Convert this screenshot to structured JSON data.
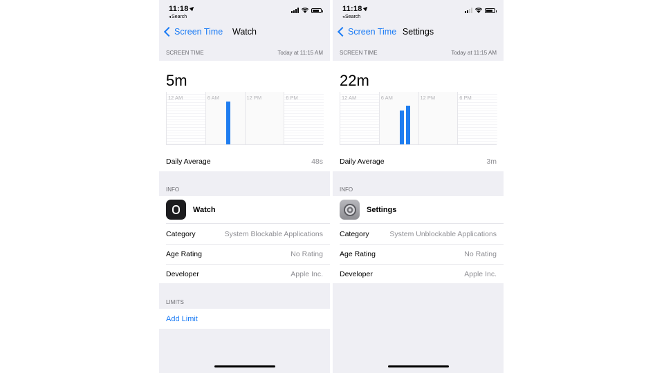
{
  "status": {
    "time": "11:18",
    "back_app": "Search"
  },
  "colors": {
    "accent": "#1a7bf5",
    "bar": "#1f7df0",
    "background": "#efeff4"
  },
  "left": {
    "nav": {
      "back_label": "Screen Time",
      "title": "Watch"
    },
    "screen_time_header": {
      "label": "SCREEN TIME",
      "timestamp": "Today at 11:15 AM"
    },
    "usage_total": "5m",
    "chart_data": {
      "type": "bar",
      "tick_labels": [
        "12 AM",
        "6 AM",
        "12 PM",
        "6 PM"
      ],
      "bars": [
        {
          "hour": 9,
          "relative_height": 1.0
        }
      ]
    },
    "daily_average": {
      "label": "Daily Average",
      "value": "48s"
    },
    "info_header": "INFO",
    "app": {
      "name": "Watch",
      "icon": "watch-app-icon"
    },
    "category": {
      "label": "Category",
      "value": "System Blockable Applications"
    },
    "age_rating": {
      "label": "Age Rating",
      "value": "No Rating"
    },
    "developer": {
      "label": "Developer",
      "value": "Apple Inc."
    },
    "limits_header": "LIMITS",
    "add_limit": "Add Limit"
  },
  "right": {
    "nav": {
      "back_label": "Screen Time",
      "title": "Settings"
    },
    "screen_time_header": {
      "label": "SCREEN TIME",
      "timestamp": "Today at 11:15 AM"
    },
    "usage_total": "22m",
    "chart_data": {
      "type": "bar",
      "tick_labels": [
        "12 AM",
        "6 AM",
        "12 PM",
        "6 PM"
      ],
      "bars": [
        {
          "hour": 9,
          "relative_height": 0.78
        },
        {
          "hour": 10,
          "relative_height": 0.9
        }
      ]
    },
    "daily_average": {
      "label": "Daily Average",
      "value": "3m"
    },
    "info_header": "INFO",
    "app": {
      "name": "Settings",
      "icon": "settings-app-icon"
    },
    "category": {
      "label": "Category",
      "value": "System Unblockable Applications"
    },
    "age_rating": {
      "label": "Age Rating",
      "value": "No Rating"
    },
    "developer": {
      "label": "Developer",
      "value": "Apple Inc."
    }
  }
}
